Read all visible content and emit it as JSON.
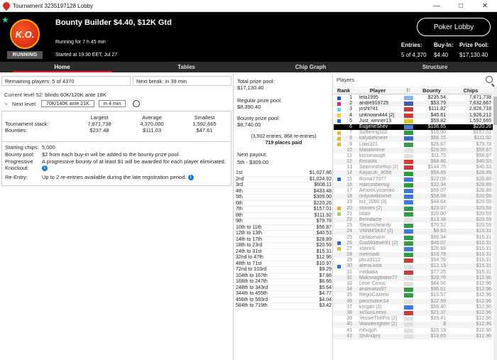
{
  "window": {
    "title": "Tournament 3235197128 Lobby"
  },
  "header": {
    "logo_text": "K.O.",
    "status_badge": "RUNNING",
    "tournament_name": "Bounty Builder $4.40, $12K Gtd",
    "running_for": "Running for 7 h 45 min",
    "started_at": "Started at 19:30 EET, Jul 27",
    "entries_label": "Entries:",
    "entries_value": "5 of 4,370",
    "buyin_label": "Buy-In:",
    "buyin_value": "$4.40",
    "prize_label": "Prize Pool:",
    "prize_value": "$17,130.40",
    "lobby_button": "Poker Lobby"
  },
  "tabs": [
    {
      "label": "Home",
      "active": true
    },
    {
      "label": "Tables",
      "active": false
    },
    {
      "label": "Chip Graph",
      "active": false
    },
    {
      "label": "Structure",
      "active": false
    }
  ],
  "home": {
    "remaining_players": "Remaining players: 5 of 4370",
    "next_break": "Next break: in 39 min",
    "current_level_label": "Current level 52:",
    "current_level_value": "blinds 60K/120K ante 18K",
    "next_level_label": "Next level:",
    "next_level_value": "70K/140K ante 21K",
    "next_level_time": "in 4 min",
    "stats_headers": [
      "",
      "Largest",
      "Average",
      "Smallest"
    ],
    "stats_rows": [
      {
        "label": "Tournament stack:",
        "largest": "7,871,738",
        "average": "4,370,000",
        "smallest": "1,592,665"
      },
      {
        "label": "Bounties:",
        "largest": "$237.48",
        "average": "$111.03",
        "smallest": "$47.61"
      }
    ],
    "starting_chips_label": "Starting chips:",
    "starting_chips_value": "5,000",
    "bounty_pool_label": "Bounty pool:",
    "bounty_pool_value": "$2 from each buy-in will be added to the bounty prize pool.",
    "progressive_label": "Progressive Knockout:",
    "progressive_value": "A progressive bounty of at least $1 will be awarded for each player eliminated.",
    "reentry_label": "Re-Entry:",
    "reentry_value": "Up to 2 re-entries available during the late registration period."
  },
  "prize": {
    "total_label": "Total prize pool:",
    "total_value": "$17,130.40",
    "regular_label": "Regular prize pool:",
    "regular_value": "$8,390.40",
    "bounty_label": "Bounty prize pool:",
    "bounty_value": "$8,740.00",
    "entries_note": "(3,502 entries, 868 re-entries)",
    "places_paid": "719 places paid",
    "next_payout_label": "Next payout:",
    "next_payout_value": "5th - $309.00",
    "payouts": [
      {
        "place": "1st",
        "amount": "$1,027.86"
      },
      {
        "place": "2nd",
        "amount": "$1,024.92"
      },
      {
        "place": "3rd",
        "amount": "$608.11"
      },
      {
        "place": "4th",
        "amount": "$433.48"
      },
      {
        "place": "5th",
        "amount": "$309.00"
      },
      {
        "place": "6th",
        "amount": "$220.26"
      },
      {
        "place": "7th",
        "amount": "$157.01"
      },
      {
        "place": "8th",
        "amount": "$111.92"
      },
      {
        "place": "9th",
        "amount": "$79.78"
      },
      {
        "place": "10th to 11th",
        "amount": "$56.87"
      },
      {
        "place": "12th to 13th",
        "amount": "$40.53"
      },
      {
        "place": "14th to 17th",
        "amount": "$28.89"
      },
      {
        "place": "18th to 23rd",
        "amount": "$20.59"
      },
      {
        "place": "24th to 31st",
        "amount": "$15.31"
      },
      {
        "place": "32nd to 47th",
        "amount": "$12.96"
      },
      {
        "place": "48th to 71st",
        "amount": "$10.97"
      },
      {
        "place": "72nd to 103rd",
        "amount": "$9.29"
      },
      {
        "place": "104th to 167th",
        "amount": "$7.86"
      },
      {
        "place": "168th to 247th",
        "amount": "$6.66"
      },
      {
        "place": "248th to 343rd",
        "amount": "$5.64"
      },
      {
        "place": "344th to 455th",
        "amount": "$4.77"
      },
      {
        "place": "456th to 583rd",
        "amount": "$4.04"
      },
      {
        "place": "584th to 719th",
        "amount": "$3.42"
      }
    ]
  },
  "players": {
    "title": "Players",
    "columns": [
      "Rank",
      "Player",
      "⚐",
      "Bounty",
      "Chips"
    ],
    "rows": [
      {
        "box": "#1d4fd8",
        "rank": "1",
        "name": "leta1995",
        "flag": "#8ab4e8",
        "bounty": "$235.54",
        "chips": "7,871,738"
      },
      {
        "box": "#d21f8c",
        "rank": "2",
        "name": "andre919725",
        "flag": "#3b5bb5",
        "bounty": "$53.79",
        "chips": "7,632,667"
      },
      {
        "box": "#5ad6f0",
        "rank": "3",
        "name": "josht741",
        "flag": "#c83a3a",
        "bounty": "$111.82",
        "chips": "2,826,718"
      },
      {
        "box": "#f2d219",
        "rank": "4",
        "name": "unknown444 [2]",
        "flag": "#d53636",
        "bounty": "$45.61",
        "chips": "1,926,212"
      },
      {
        "box": "#2a66e0",
        "rank": "5",
        "name": "Just_winner13",
        "flag": "#e8c21a",
        "bounty": "$59.82",
        "chips": "1,592,665"
      },
      {
        "box": "",
        "rank": "6",
        "name": "EugeneShev",
        "flag": "#4a7fd0",
        "bounty": "$106.65",
        "chips": "$220.26",
        "sel": true
      },
      {
        "box": "#e9b233",
        "rank": "7",
        "name": "Suffering102",
        "flag": "#2f9b46",
        "bounty": "$15.00",
        "chips": "$157.01",
        "elim": true
      },
      {
        "box": "#e9b233",
        "rank": "8",
        "name": "kalydahmeer",
        "flag": "#3a6bc4",
        "bounty": "$56.15",
        "chips": "$111.92",
        "elim": true
      },
      {
        "box": "#e9b233",
        "rank": "9",
        "name": "Lilas321",
        "flag": "#2f9b46",
        "bounty": "$26.67",
        "chips": "$79.78",
        "elim": true
      },
      {
        "box": "",
        "rank": "10",
        "name": "Mastitimme",
        "flag": "#e0e0e0",
        "bounty": "$28.50",
        "chips": "$56.87",
        "elim": true
      },
      {
        "box": "",
        "rank": "11",
        "name": "kiicsimaugh",
        "flag": "#e0e0e0",
        "bounty": "$11.75",
        "chips": "$56.87",
        "elim": true
      },
      {
        "box": "",
        "rank": "12",
        "name": "Encalifa",
        "flag": "#d93b2b",
        "bounty": "$68.86",
        "chips": "$40.53",
        "elim": true
      },
      {
        "box": "",
        "rank": "13",
        "name": "Seanontheflop [2]",
        "flag": "#c93b3b",
        "bounty": "$144.75",
        "chips": "$40.53",
        "elim": true
      },
      {
        "box": "",
        "rank": "14",
        "name": "KayaLiK_9058",
        "flag": "#2a9c44",
        "bounty": "$58.65",
        "chips": "$28.89",
        "elim": true
      },
      {
        "box": "#2a66e0",
        "rank": "15",
        "name": "Roma77077",
        "flag": "#3e7ad8",
        "bounty": "$22.08",
        "chips": "$28.89",
        "elim": true
      },
      {
        "box": "",
        "rank": "16",
        "name": "marcosberlug",
        "flag": "#2f9b46",
        "bounty": "$32.34",
        "chips": "$28.89",
        "elim": true
      },
      {
        "box": "",
        "rank": "17",
        "name": "ArhomLyssenko",
        "flag": "#3e7ad8",
        "bounty": "$59.07",
        "chips": "$28.89",
        "elim": true
      },
      {
        "box": "",
        "rank": "18",
        "name": "onlyuwilllovme",
        "flag": "#3e7ad8",
        "bounty": "$58.08",
        "chips": "$20.59",
        "elim": true
      },
      {
        "box": "",
        "rank": "19",
        "name": "biz_2000 [3]",
        "flag": "#3e7ad8",
        "bounty": "$44.64",
        "chips": "$20.59",
        "elim": true
      },
      {
        "box": "#e9b233",
        "rank": "20",
        "name": "stonies [2]",
        "flag": "#2f9b46",
        "bounty": "$23.07",
        "chips": "$20.59",
        "elim": true
      },
      {
        "box": "#9bd66a",
        "rank": "21",
        "name": "lillalo",
        "flag": "#2f9b46",
        "bounty": "$20.00",
        "chips": "$20.59",
        "elim": true
      },
      {
        "box": "",
        "rank": "22",
        "name": "Berndacle",
        "flag": "#e0e0e0",
        "bounty": "$13.38",
        "chips": "$20.59",
        "elim": true
      },
      {
        "box": "",
        "rank": "23",
        "name": "Sleamsheardy",
        "flag": "#2f9b46",
        "bounty": "$70.52",
        "chips": "$20.59",
        "elim": true
      },
      {
        "box": "",
        "rank": "24",
        "name": "VNNMSK87 [2]",
        "flag": "#3e7ad8",
        "bounty": "$9.63",
        "chips": "$15.31",
        "elim": true
      },
      {
        "box": "",
        "rank": "25",
        "name": "carlaomarin",
        "flag": "#2f9b46",
        "bounty": "$66.94",
        "chips": "$15.31",
        "elim": true
      },
      {
        "box": "#2a66e0",
        "rank": "26",
        "name": "GusWildner91 [2]",
        "flag": "#2f9b46",
        "bounty": "$45.07",
        "chips": "$15.31",
        "elim": true
      },
      {
        "box": "#e9b233",
        "rank": "27",
        "name": "xotinn0",
        "flag": "#3e7ad8",
        "bounty": "$26.68",
        "chips": "$15.31",
        "elim": true
      },
      {
        "box": "",
        "rank": "28",
        "name": "memsaib",
        "flag": "#2f9b46",
        "bounty": "$19.78",
        "chips": "$15.31",
        "elim": true
      },
      {
        "box": "",
        "rank": "29",
        "name": "ptica3112",
        "flag": "#c93b3b",
        "bounty": "$54.76",
        "chips": "$15.31",
        "elim": true
      },
      {
        "box": "#2a66e0",
        "rank": "30",
        "name": "alena.kola",
        "flag": "#e0e0e0",
        "bounty": "$12.13",
        "chips": "$15.31",
        "elim": true
      },
      {
        "box": "",
        "rank": "31",
        "name": "milibaba",
        "flag": "#c93b3b",
        "bounty": "$77.25",
        "chips": "$15.31",
        "elim": true
      },
      {
        "box": "",
        "rank": "32",
        "name": "Maksnagibator77",
        "flag": "#e0e0e0",
        "bounty": "$28.76",
        "chips": "$12.96",
        "elim": true
      },
      {
        "box": "",
        "rank": "33",
        "name": "Leon Crncic",
        "flag": "#e0e0e0",
        "bounty": "$84.56",
        "chips": "$12.96",
        "elim": true
      },
      {
        "box": "",
        "rank": "34",
        "name": "andmatos97",
        "flag": "#2f9b46",
        "bounty": "$96.61",
        "chips": "$12.96",
        "elim": true
      },
      {
        "box": "",
        "rank": "35",
        "name": "RégisCastelo",
        "flag": "#2f9b46",
        "bounty": "$15.57",
        "chips": "$12.96",
        "elim": true
      },
      {
        "box": "",
        "rank": "36",
        "name": "pancholion14",
        "flag": "#e0e0e0",
        "bounty": "$22.59",
        "chips": "$12.96",
        "elim": true
      },
      {
        "box": "",
        "rank": "37",
        "name": "korgan [3]",
        "flag": "#3e7ad8",
        "bounty": "$58.40",
        "chips": "$12.96",
        "elim": true
      },
      {
        "box": "",
        "rank": "38",
        "name": "xxSunLeexx",
        "flag": "#c93b3b",
        "bounty": "$21.37",
        "chips": "$12.96",
        "elim": true
      },
      {
        "box": "",
        "rank": "39",
        "name": "YessieThePro [2]",
        "flag": "#e0e0e0",
        "bounty": "$15.41",
        "chips": "$12.96",
        "elim": true
      },
      {
        "box": "",
        "rank": "40",
        "name": "Wanderlighter [2]",
        "flag": "#e0e0e0",
        "bounty": "$",
        "chips": "$12.96",
        "elim": true
      },
      {
        "box": "",
        "rank": "41",
        "name": "mhugzh",
        "flag": "#e0e0e0",
        "bounty": "$15.19",
        "chips": "$12.96",
        "elim": true
      },
      {
        "box": "",
        "rank": "42",
        "name": "ShAndjey",
        "flag": "#e0e0e0",
        "bounty": "$18.69",
        "chips": "$12.96",
        "elim": true
      }
    ]
  }
}
